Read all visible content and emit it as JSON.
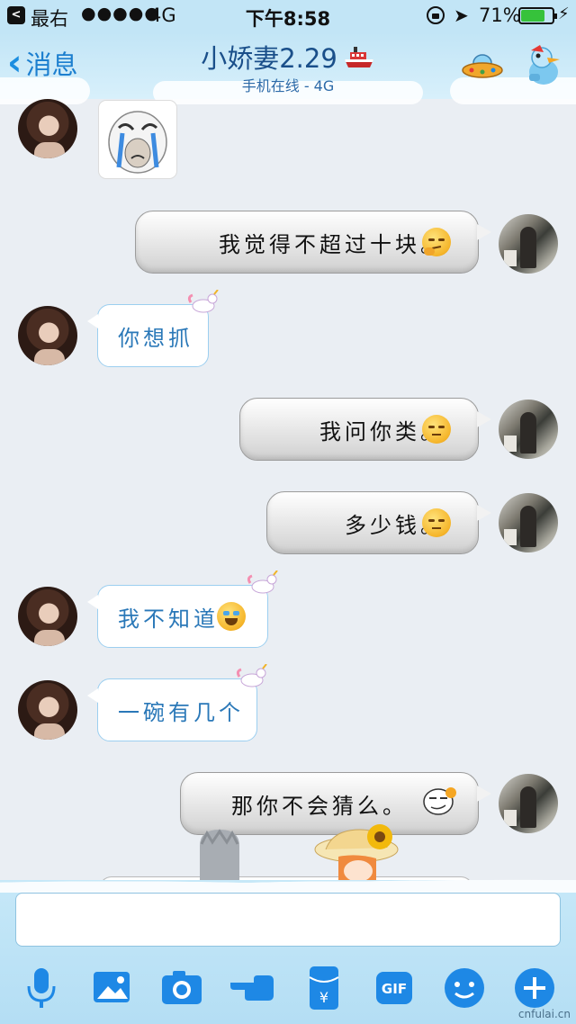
{
  "status_bar": {
    "back_app_glyph": "<",
    "carrier": "最右",
    "signal": "●●●●●",
    "network": "4G",
    "time": "下午8:58",
    "location_glyph": "➤",
    "battery_percent": "71%",
    "battery_level": 0.71,
    "charging_glyph": "⚡"
  },
  "header": {
    "back_label": "消息",
    "back_chevron": "‹",
    "title": "小娇妻2.29",
    "subtitle": "手机在线 - 4G",
    "icons": [
      "chevron-left-icon",
      "ship-icon",
      "ufo-icon",
      "duck-icon"
    ]
  },
  "messages": [
    {
      "sender": "her",
      "type": "sticker",
      "sticker": "crying-meme-sticker"
    },
    {
      "sender": "me",
      "text": "我觉得不超过十块。",
      "emoji": "thinking-emoji"
    },
    {
      "sender": "her",
      "text": "你想抓",
      "decoration": "unicorn-icon"
    },
    {
      "sender": "me",
      "text": "我问你类。",
      "emoji": "unamused-emoji"
    },
    {
      "sender": "me",
      "text": "多少钱。",
      "emoji": "unamused-emoji"
    },
    {
      "sender": "her",
      "text": "我不知道",
      "emoji": "laughing-tears-emoji",
      "decoration": "unicorn-icon"
    },
    {
      "sender": "her",
      "text": "一碗有几个",
      "decoration": "unicorn-icon"
    },
    {
      "sender": "me",
      "text": "那你不会猜么。",
      "emoji": "smirk-face-sticker"
    }
  ],
  "input": {
    "value": "",
    "placeholder": ""
  },
  "toolbar": {
    "gif_label": "GIF",
    "yen_label": "¥",
    "items": [
      "voice-icon",
      "image-icon",
      "camera-icon",
      "poke-hand-icon",
      "red-packet-icon",
      "gif-icon",
      "emoji-icon",
      "plus-icon"
    ]
  },
  "watermark": "cnfulai.cn",
  "colors": {
    "header_bg": "#c2e5f6",
    "accent_blue": "#1c8ee0",
    "incoming_text": "#2a78b8",
    "chat_bg": "#eaeef3",
    "battery_green": "#36c23b"
  }
}
